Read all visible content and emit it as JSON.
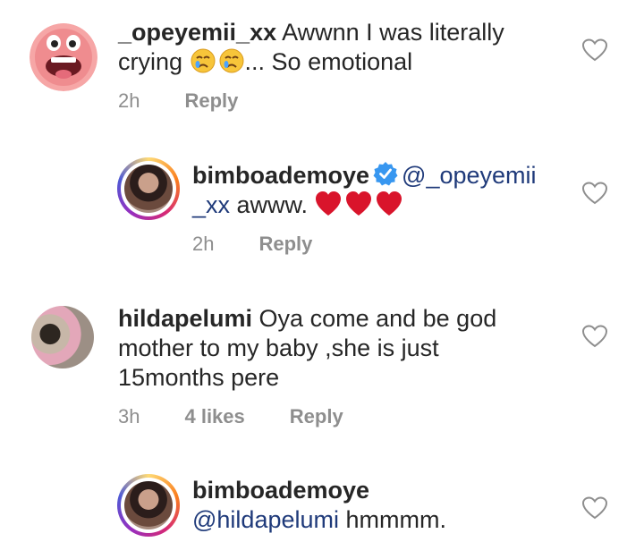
{
  "comments": [
    {
      "username": "_opeyemii_xx",
      "text_before": "Awwnn I was literally crying ",
      "emoji": "crying-face-emoji x2",
      "text_after": "... So emotional",
      "time": "2h",
      "reply": "Reply"
    },
    {
      "username": "bimboademoye",
      "mention": "@_opeyemii _xx",
      "text": " awww.",
      "emoji": "red-heart-emoji x3",
      "time": "2h",
      "reply": "Reply"
    },
    {
      "username": "hildapelumi",
      "text": "Oya come and be god mother to my baby ,she is just 15months pere",
      "time": "3h",
      "likes": "4 likes",
      "reply": "Reply"
    },
    {
      "username": "bimboademoye",
      "mention": "@hildapelumi",
      "text": " hmmmm."
    }
  ],
  "colors": {
    "text": "#262626",
    "meta": "#8e8e8e",
    "mention": "#1f3a7a",
    "verified": "#3897f0",
    "heart_emoji": "#d9142b"
  }
}
